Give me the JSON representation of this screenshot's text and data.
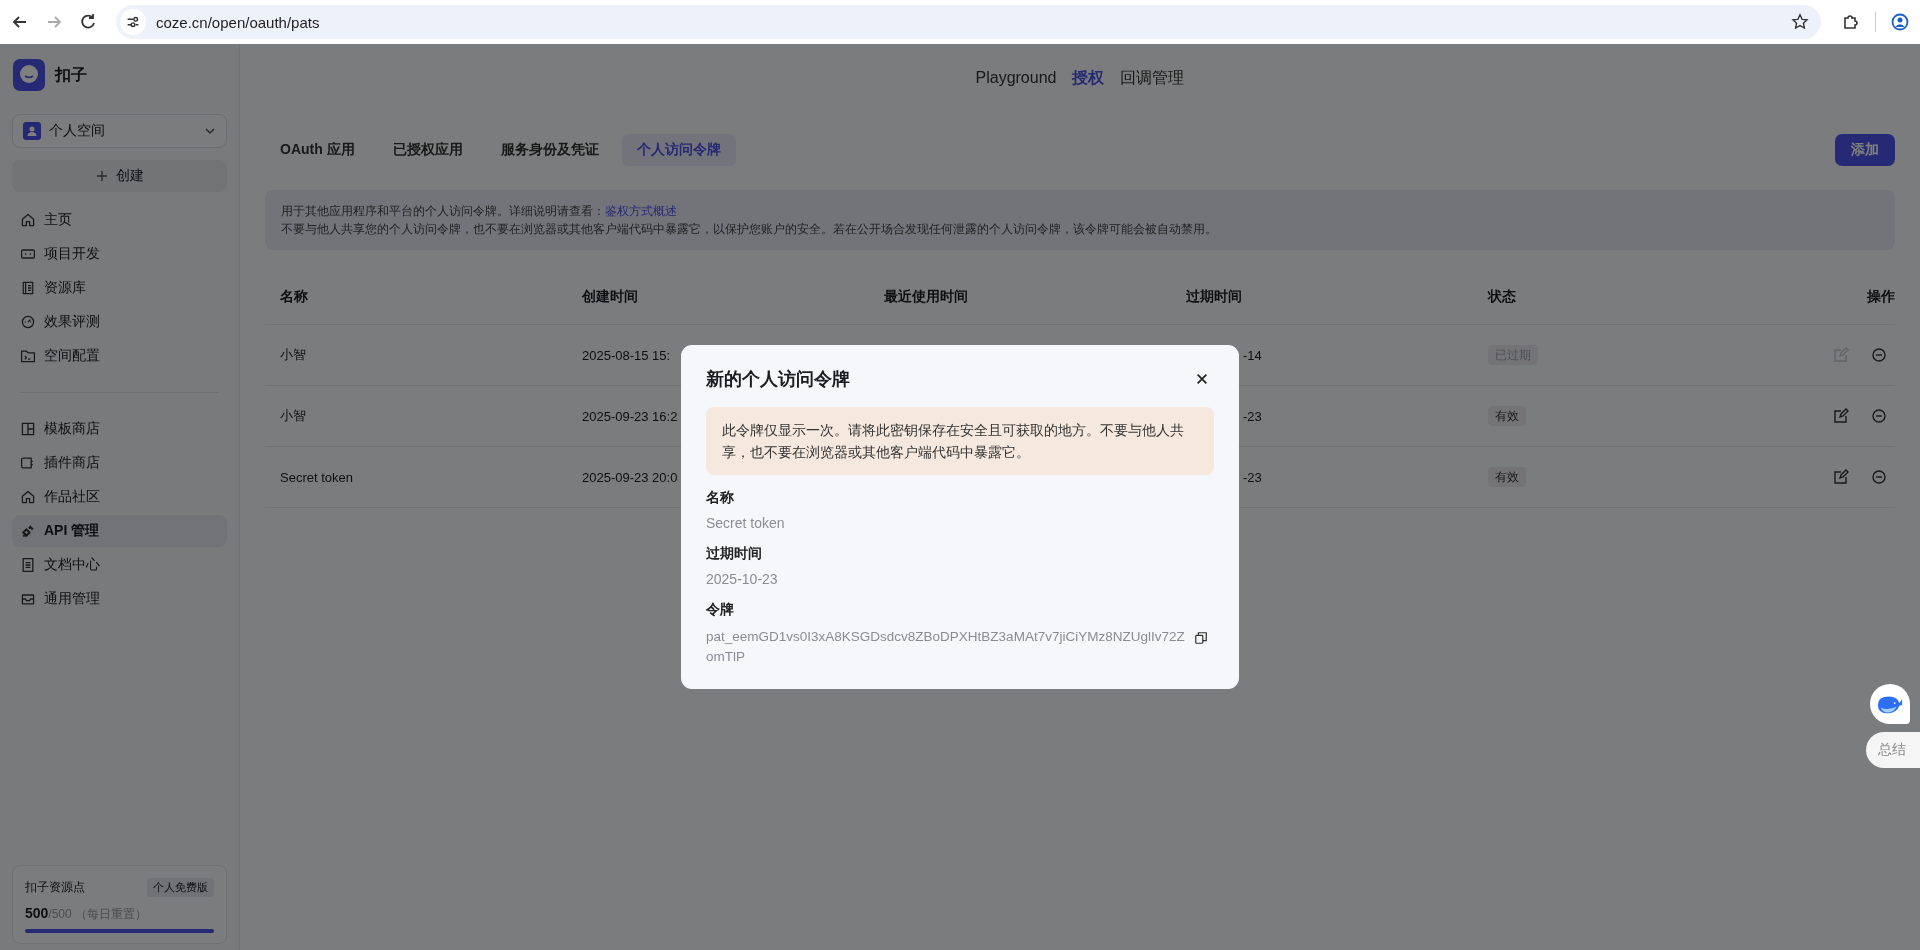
{
  "browser": {
    "url": "coze.cn/open/oauth/pats"
  },
  "sidebar": {
    "app_name": "扣子",
    "workspace": "个人空间",
    "create_button": "创建",
    "items": [
      {
        "label": "主页",
        "selected": false
      },
      {
        "label": "项目开发",
        "selected": false
      },
      {
        "label": "资源库",
        "selected": false
      },
      {
        "label": "效果评测",
        "selected": false
      },
      {
        "label": "空间配置",
        "selected": false
      }
    ],
    "items_2": [
      {
        "label": "模板商店",
        "selected": false
      },
      {
        "label": "插件商店",
        "selected": false
      },
      {
        "label": "作品社区",
        "selected": false
      },
      {
        "label": "API 管理",
        "selected": true
      },
      {
        "label": "文档中心",
        "selected": false
      },
      {
        "label": "通用管理",
        "selected": false
      }
    ],
    "quota": {
      "title": "扣子资源点",
      "plan": "个人免费版",
      "used": "500",
      "total": "/500",
      "reset_note": "（每日重置）",
      "level": 1
    }
  },
  "top_nav": [
    {
      "label": "Playground",
      "selected": false
    },
    {
      "label": "授权",
      "selected": true
    },
    {
      "label": "回调管理",
      "selected": false
    }
  ],
  "tabs": [
    {
      "label": "OAuth 应用",
      "selected": false
    },
    {
      "label": "已授权应用",
      "selected": false
    },
    {
      "label": "服务身份及凭证",
      "selected": false
    },
    {
      "label": "个人访问令牌",
      "selected": true
    }
  ],
  "add_button": "添加",
  "notice": {
    "text": "用于其他应用程序和平台的个人访问令牌。详细说明请查看：",
    "link": "鉴权方式概述",
    "text_2": "不要与他人共享您的个人访问令牌，也不要在浏览器或其他客户端代码中暴露它，以保护您账户的安全。若在公开场合发现任何泄露的个人访问令牌，该令牌可能会被自动禁用。"
  },
  "table": {
    "columns": [
      "名称",
      "创建时间",
      "最近使用时间",
      "过期时间",
      "状态",
      "操作"
    ],
    "rows": [
      {
        "name": "小智",
        "created": "2025-08-15 15:",
        "expires": "-14",
        "status": "已过期",
        "expired": true
      },
      {
        "name": "小智",
        "created": "2025-09-23 16:2",
        "expires": "-23",
        "status": "有效",
        "expired": false
      },
      {
        "name": "Secret token",
        "created": "2025-09-23 20:0",
        "expires": "-23",
        "status": "有效",
        "expired": false
      }
    ]
  },
  "dialog": {
    "title": "新的个人访问令牌",
    "warning": "此令牌仅显示一次。请将此密钥保存在安全且可获取的地方。不要与他人共享，也不要在浏览器或其他客户端代码中暴露它。",
    "fields": [
      {
        "label": "名称",
        "value": "Secret token"
      },
      {
        "label": "过期时间",
        "value": "2025-10-23"
      },
      {
        "label": "令牌",
        "value": "pat_eemGD1vs0I3xA8KSGDsdcv8ZBoDPXHtBZ3aMAt7v7jiCiYMz8NZUglIv72ZomTlP",
        "kind": "token"
      }
    ]
  },
  "float": {
    "summary_label": "总结"
  }
}
